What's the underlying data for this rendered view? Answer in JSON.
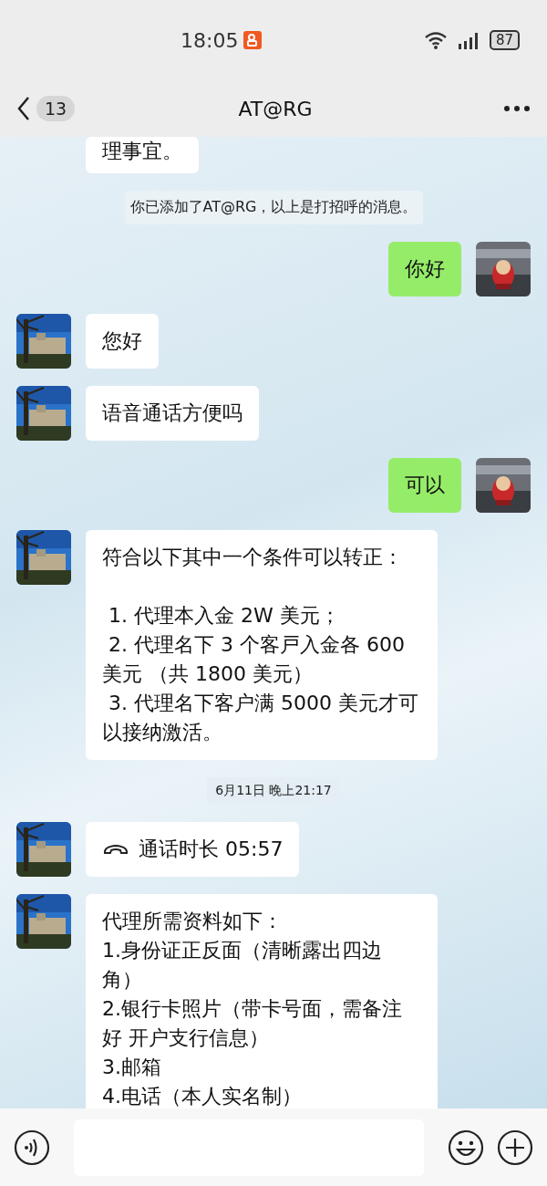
{
  "status_bar": {
    "time": "18:05",
    "battery": "87"
  },
  "header": {
    "back_count": "13",
    "title": "AT@RG"
  },
  "messages": [
    {
      "kind": "cut_text",
      "outgoing": false,
      "text": "理事宜。"
    },
    {
      "kind": "system",
      "text": "你已添加了AT@RG，以上是打招呼的消息。"
    },
    {
      "kind": "text",
      "outgoing": true,
      "text": "你好"
    },
    {
      "kind": "text",
      "outgoing": false,
      "text": "您好"
    },
    {
      "kind": "text",
      "outgoing": false,
      "text": "语音通话方便吗"
    },
    {
      "kind": "text",
      "outgoing": true,
      "text": "可以"
    },
    {
      "kind": "text",
      "outgoing": false,
      "text": "符合以下其中一个条件可以转正：\n\n 1. 代理本入金 2W 美元；\n 2. 代理名下 3 个客戸入金各 600 美元 （共 1800 美元）\n 3. 代理名下客户满 5000 美元才可以接纳激活。"
    },
    {
      "kind": "time",
      "text": "6月11日 晚上21:17"
    },
    {
      "kind": "call",
      "outgoing": false,
      "text": "通话时长 05:57"
    },
    {
      "kind": "text",
      "outgoing": false,
      "text": "代理所需资料如下：\n1.身份证正反面（清晰露出四边角）\n2.银行卡照片（带卡号面，需备注好 开户支行信息）\n3.邮箱\n4.电话（本人实名制）"
    }
  ]
}
